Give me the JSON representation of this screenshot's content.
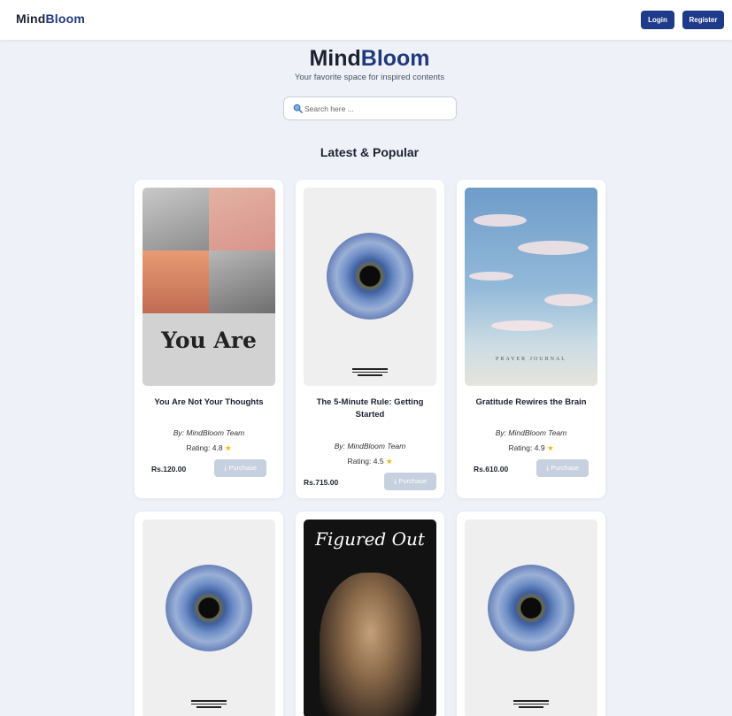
{
  "navbar": {
    "logo_part1": "Mind",
    "logo_part2": "Bloom",
    "login_label": "Login",
    "register_label": "Register"
  },
  "hero": {
    "title_part1": "Mind",
    "title_part2": "Bloom",
    "tagline": "Your favorite space for inspired contents",
    "search_placeholder": "Search here ..."
  },
  "section_title": "Latest & Popular",
  "books": [
    {
      "title": "You Are Not Your Thoughts",
      "cover_text": "You Are",
      "author": "By: MindBloom Team",
      "rating": "Rating: 4.8",
      "price": "Rs.120.00",
      "purchase_label": "Purchase"
    },
    {
      "title": "The 5-Minute Rule: Getting Started",
      "author": "By: MindBloom Team",
      "rating": "Rating: 4.5",
      "price": "Rs.715.00",
      "purchase_label": "Purchase"
    },
    {
      "title": "Gratitude Rewires the Brain",
      "cover_text": "PRAYER JOURNAL",
      "author": "By: MindBloom Team",
      "rating": "Rating: 4.9",
      "price": "Rs.610.00",
      "purchase_label": "Purchase"
    },
    {
      "title": ""
    },
    {
      "title": "",
      "cover_text": "Figured Out"
    },
    {
      "title": ""
    }
  ],
  "colors": {
    "brand_blue": "#1f3a7a",
    "button_blue": "#203a8a",
    "star": "#f2b705",
    "disabled_button": "#c6d0de"
  },
  "icons": {
    "search": "search-icon",
    "star": "star-icon",
    "download": "download-icon"
  }
}
